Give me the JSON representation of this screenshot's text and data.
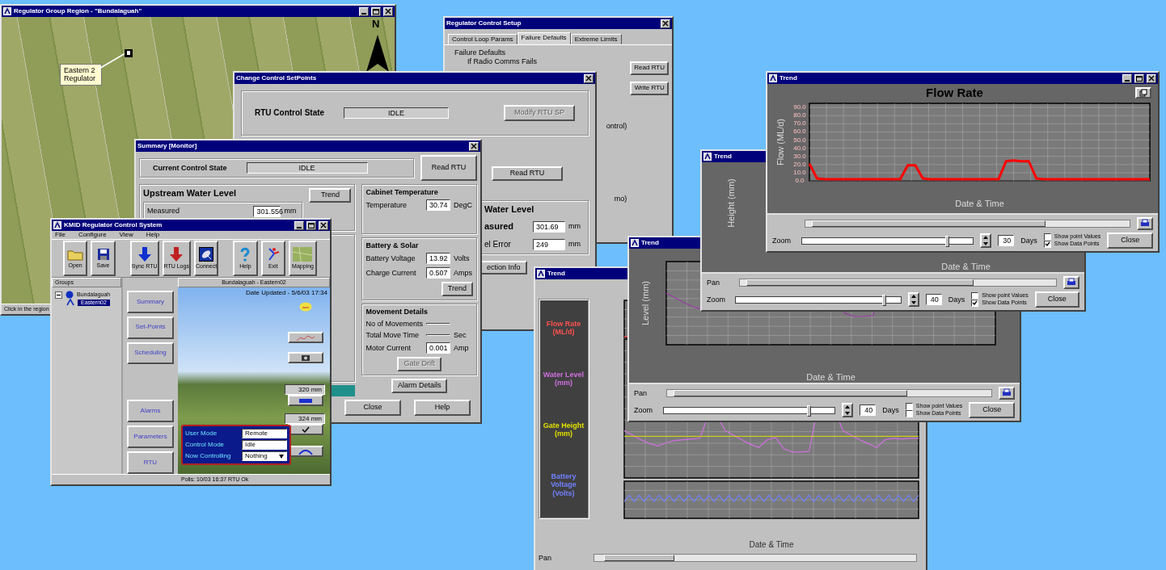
{
  "windows": [
    {
      "kind": "map",
      "title": "Regulator Group Region - \"Bundalaguah\"",
      "callout": "Eastern 2 Regulator",
      "north_label": "N",
      "status": "Click in the region"
    },
    {
      "kind": "setup",
      "title": "Regulator Control Setup",
      "tabs": [
        {
          "label": "Control Loop Params",
          "selected": false
        },
        {
          "label": "Failure Defaults",
          "selected": true
        },
        {
          "label": "Extreme Limits",
          "selected": false
        }
      ],
      "group_title": "Failure Defaults",
      "option": "If Radio Comms Fails",
      "notes": [
        "ontrol)",
        "mo)"
      ],
      "buttons": [
        "Read RTU",
        "Write RTU"
      ]
    },
    {
      "kind": "setpoints",
      "title": "Change Control SetPoints",
      "state_label": "RTU Control State",
      "state_value": "IDLE",
      "modify_button": {
        "label": "Modify RTU SP",
        "disabled": true
      },
      "read_button": "Read RTU",
      "group_title": "Water Level",
      "rows": [
        {
          "label": "asured",
          "value": "301.69",
          "unit": "mm"
        },
        {
          "label": "el Error",
          "value": "249",
          "unit": "mm"
        }
      ],
      "info_button": "ection Info"
    },
    {
      "kind": "summary",
      "title": "Summary [Monitor]",
      "state_label": "Current Control State",
      "state_value": "IDLE",
      "read_button": "Read RTU",
      "upstream": {
        "title": "Upstream Water Level",
        "label": "Measured",
        "value": "301.556",
        "unit": "mm",
        "button": "Trend"
      },
      "groups": [
        {
          "title": "Cabinet Temperature",
          "rows": [
            {
              "label": "Temperature",
              "value": "30.74",
              "unit": "DegC"
            }
          ]
        },
        {
          "title": "Battery & Solar",
          "rows": [
            {
              "label": "Battery Voltage",
              "value": "13.92",
              "unit": "Volts"
            },
            {
              "label": "Charge Current",
              "value": "0.507",
              "unit": "Amps"
            }
          ],
          "button": {
            "label": "Trend",
            "disabled": false
          }
        },
        {
          "title": "Movement Details",
          "rows": [
            {
              "label": "No of Movements"
            },
            {
              "label": "Total Move Time",
              "unit": "Sec"
            },
            {
              "label": "Motor Current",
              "value": "0.001",
              "unit": "Amp"
            }
          ],
          "button": {
            "label": "Gate Drift",
            "disabled": true
          }
        }
      ],
      "alarm_button": "Alarm Details",
      "footer_buttons": [
        "Close",
        "Help"
      ]
    },
    {
      "kind": "main",
      "title": "KMID Regulator Control System",
      "menu": [
        "File",
        "Configure",
        "View",
        "Help"
      ],
      "toolbar": [
        {
          "label": "Open"
        },
        {
          "label": "Save"
        },
        {
          "label": "Sync RTU"
        },
        {
          "label": "RTU Logs"
        },
        {
          "label": "Connect"
        },
        {
          "label": "Help"
        },
        {
          "label": "Exit"
        },
        {
          "label": "Mapping"
        }
      ],
      "tree_header": "Groups",
      "tree": [
        {
          "label": "Bundalaguah",
          "expanded": true,
          "selected": false,
          "children": [
            {
              "label": "Eastern02",
              "selected": true
            }
          ]
        }
      ],
      "nav": [
        "Summary",
        "Set-Points",
        "Scheduling",
        "Alarms",
        "Parameters",
        "RTU"
      ],
      "site_title": "Bundalaguah - Eastern02",
      "updated": "Date Updated - 5/6/03 17:34",
      "readouts": [
        "320 mm",
        "324 mm"
      ],
      "panel": [
        {
          "label": "User Mode",
          "value": "Remote",
          "kind": "field"
        },
        {
          "label": "Control Mode",
          "value": "Idle",
          "kind": "field"
        },
        {
          "label": "Now Controlling",
          "value": "Nothing",
          "kind": "dropdown"
        }
      ],
      "status": "Polls: 10/03 16:37  RTU Ok"
    },
    {
      "kind": "trend_multi",
      "title": "Trend",
      "legend": [
        {
          "label": "Flow Rate (ML/d)",
          "color": "#ff5050"
        },
        {
          "label": "Water Level (mm)",
          "color": "#d070e0"
        },
        {
          "label": "Gate Height (mm)",
          "color": "#e0e000"
        },
        {
          "label": "Battery Voltage (Volts)",
          "color": "#7080ff"
        }
      ],
      "xlabel": "Date & Time",
      "pan_label": "Pan"
    },
    {
      "kind": "trend_level",
      "title": "Trend",
      "ylabel": "Level (mm)",
      "xlabel": "Date & Time",
      "pan_label": "Pan",
      "zoom_label": "Zoom",
      "zoom": {
        "level": 0.85
      },
      "days": "40",
      "days_label": "Days",
      "options": [
        {
          "label": "Show point Values",
          "checked": false
        },
        {
          "label": "Show Data Points",
          "checked": false
        }
      ],
      "close": "Close"
    },
    {
      "kind": "trend_height",
      "title": "Trend",
      "ylabel": "Height (mm)",
      "xlabel": "Date & Time",
      "pan_label": "Pan",
      "zoom_label": "Zoom",
      "zoom": {
        "level": 0.9
      },
      "days": "40",
      "days_label": "Days",
      "options": [
        {
          "label": "Show point Values",
          "checked": false
        },
        {
          "label": "Show Data Points",
          "checked": true
        }
      ],
      "close": "Close"
    },
    {
      "kind": "trend_flow",
      "title": "Trend",
      "zoom_label": "Zoom",
      "zoom": {
        "level": 0.85
      },
      "days": "30",
      "days_label": "Days",
      "options": [
        {
          "label": "Show point Values",
          "checked": false
        },
        {
          "label": "Show Data Points",
          "checked": true
        }
      ],
      "close": "Close",
      "chart_data": {
        "type": "line",
        "title": "Flow Rate",
        "xlabel": "Date & Time",
        "ylabel": "Flow (ML/d)",
        "ylim": [
          0,
          95
        ],
        "grid": true,
        "yticks": [
          {
            "value": 0,
            "label": "0.0"
          },
          {
            "value": 10,
            "label": "10.0"
          },
          {
            "value": 20,
            "label": "20.0"
          },
          {
            "value": 30,
            "label": "30.0"
          },
          {
            "value": 40,
            "label": "40.0"
          },
          {
            "value": 50,
            "label": "50.0"
          },
          {
            "value": 60,
            "label": "60.0"
          },
          {
            "value": 70,
            "label": "70.0"
          },
          {
            "value": 80,
            "label": "80.0"
          },
          {
            "value": 90,
            "label": "90.0"
          }
        ],
        "series": [
          {
            "color": "#ff0000",
            "values": [
              21,
              3,
              2,
              2,
              2,
              2,
              2,
              2,
              2,
              2,
              2,
              2,
              2,
              19,
              19,
              3,
              2,
              2,
              2,
              2,
              2,
              2,
              2,
              2,
              2,
              2,
              24,
              25,
              24,
              24,
              3,
              2,
              2,
              2,
              2,
              2,
              2,
              2,
              2,
              2,
              2,
              2,
              2,
              2,
              2,
              2
            ]
          }
        ]
      }
    }
  ]
}
